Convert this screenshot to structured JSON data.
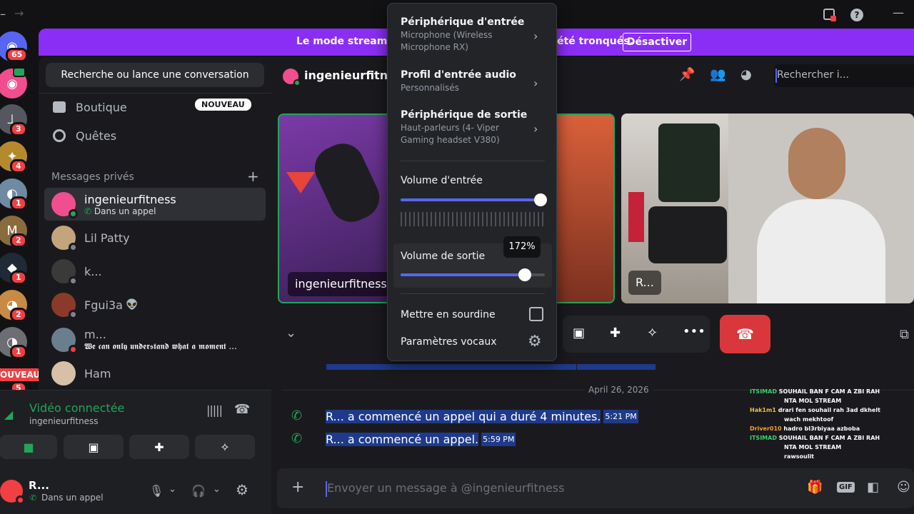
{
  "banner": {
    "text_left": "Le mode streamer e",
    "text_right": "été tronqués.",
    "button": "Désactiver",
    "color": "#8b2ef5"
  },
  "rail": {
    "badges": [
      "65",
      "3",
      "4",
      "1",
      "2",
      "1",
      "2",
      "1",
      "5"
    ],
    "new_label": "OUVEAU"
  },
  "sidebar": {
    "search": "Recherche ou lance une conversation",
    "shop": "Boutique",
    "shop_badge": "NOUVEAU",
    "quests": "Quêtes",
    "dm_header": "Messages privés",
    "dm_add": "+",
    "dms": [
      {
        "name": "ingenieurfitness",
        "sub": "Dans un appel"
      },
      {
        "name": "Lil Patty",
        "sub": ""
      },
      {
        "name": "k...",
        "sub": ""
      },
      {
        "name": "Fgui3a",
        "sub": ""
      },
      {
        "name": "m...",
        "sub": "𝖂𝖊 𝖈𝖆𝖓 𝖔𝖓𝖑𝖞 𝖚𝖓𝖉𝖊𝖗𝖘𝖙𝖆𝖓𝖉 𝖜𝖍𝖆𝖙 𝖆 𝖒𝖔𝖒𝖊𝖓𝖙 ..."
      },
      {
        "name": "Ham",
        "sub": ""
      }
    ],
    "voice_status": "Vidéo connectée",
    "voice_channel": "ingenieurfitness",
    "user_name": "R...",
    "user_status": "Dans un appel"
  },
  "header": {
    "name": "ingenieurfitness",
    "search_placeholder": "Rechercher i..."
  },
  "tiles": [
    {
      "label": "ingenieurfitness"
    },
    {
      "label": "R..."
    }
  ],
  "messages": {
    "date": "April 26, 2026",
    "items": [
      {
        "text": "R... a commencé un appel qui a duré 4 minutes.",
        "time": "5:21 PM"
      },
      {
        "text": "R... a commencé un appel.",
        "time": "5:59 PM"
      }
    ],
    "input_placeholder": "Envoyer un message à @ingenieurfitness"
  },
  "chat_overlay": [
    {
      "user": "ITSIMAD",
      "color": "#3ecf6e",
      "text": "SOUHAIL BAN F CAM A ZBI RAH"
    },
    {
      "user": "",
      "color": "#ffffff",
      "text": "NTA MOL STREAM"
    },
    {
      "user": "Hak1m1",
      "color": "#f0c040",
      "text": "drari fen souhail rah 3ad dkhelt"
    },
    {
      "user": "",
      "color": "#ffffff",
      "text": "wach mekhtoof"
    },
    {
      "user": "Driver010",
      "color": "#f0a030",
      "text": "hadro bl3rbiyaa azboba"
    },
    {
      "user": "ITSIMAD",
      "color": "#3ecf6e",
      "text": "SOUHAIL BAN F CAM A ZBI RAH"
    },
    {
      "user": "",
      "color": "#ffffff",
      "text": "NTA MOL STREAM"
    },
    {
      "user": "",
      "color": "#e23c3c",
      "text": "rawsoulit"
    }
  ],
  "popup": {
    "input_device_title": "Périphérique d'entrée",
    "input_device_value": "Microphone (Wireless Microphone RX)",
    "input_profile_title": "Profil d'entrée audio",
    "input_profile_value": "Personnalisés",
    "output_device_title": "Périphérique de sortie",
    "output_device_value": "Haut-parleurs (4- Viper Gaming headset V380)",
    "input_volume_label": "Volume d'entrée",
    "input_volume_level": 1.0,
    "output_volume_label": "Volume de sortie",
    "output_volume_tooltip": "172%",
    "output_volume_level": 0.86,
    "mute_label": "Mettre en sourdine",
    "voice_settings_label": "Paramètres vocaux"
  },
  "colors": {
    "accent": "#5865f2",
    "green": "#23a559",
    "danger": "#da373c"
  }
}
